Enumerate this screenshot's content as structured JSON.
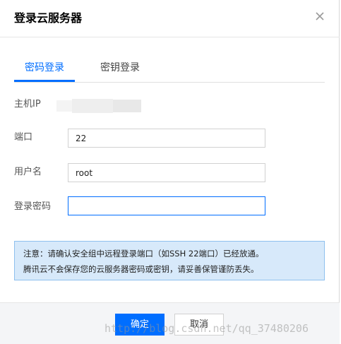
{
  "dialog": {
    "title": "登录云服务器",
    "close_icon": "close-icon"
  },
  "tabs": [
    {
      "label": "密码登录",
      "active": true
    },
    {
      "label": "密钥登录",
      "active": false
    }
  ],
  "form": {
    "host_ip_label": "主机IP",
    "port_label": "端口",
    "port_value": "22",
    "username_label": "用户名",
    "username_value": "root",
    "password_label": "登录密码",
    "password_value": ""
  },
  "notice": {
    "line1": "注意：请确认安全组中远程登录端口（如SSH 22端口）已经放通。",
    "line2": "腾讯云不会保存您的云服务器密码或密钥，请妥善保管谨防丢失。"
  },
  "footer": {
    "confirm_label": "确定",
    "cancel_label": "取消"
  },
  "watermark": "http://blog.csdn.net/qq_37480206",
  "colors": {
    "accent": "#006eff",
    "notice_bg": "#d7e9fa",
    "notice_border": "#8ec0ee",
    "footer_bg": "#f4f5f7"
  }
}
